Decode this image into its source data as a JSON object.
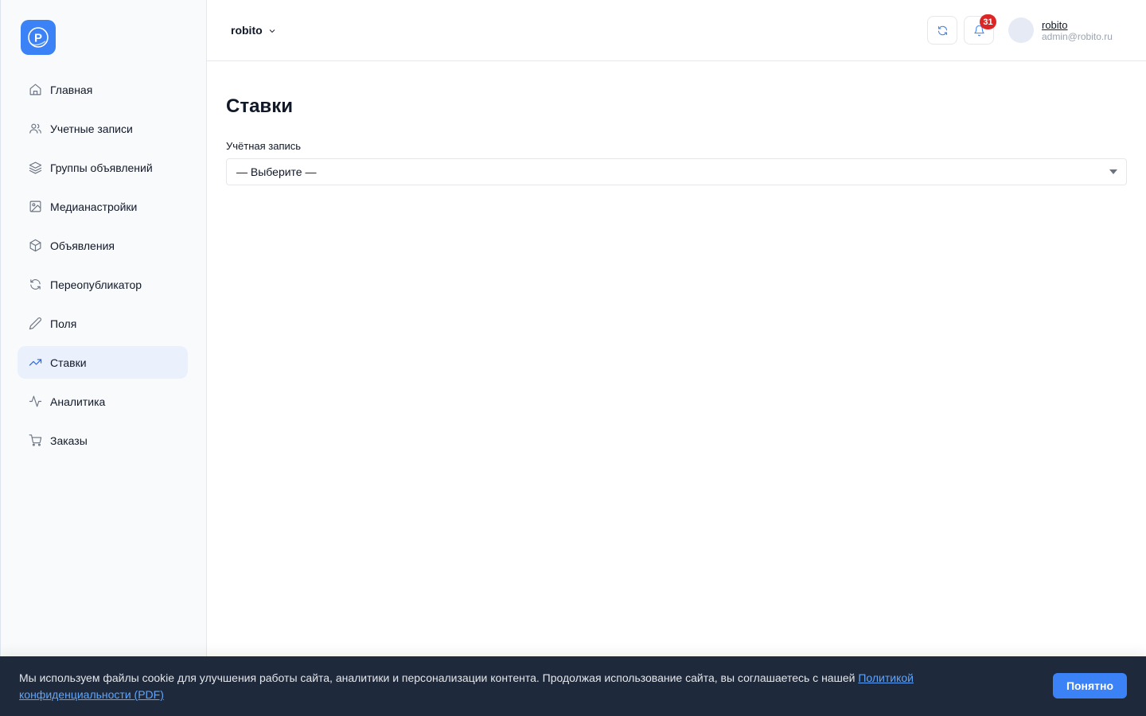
{
  "logo": {
    "letter": "P"
  },
  "sidebar": {
    "items": [
      {
        "label": "Главная",
        "icon": "home-icon"
      },
      {
        "label": "Учетные записи",
        "icon": "users-icon"
      },
      {
        "label": "Группы объявлений",
        "icon": "layers-icon"
      },
      {
        "label": "Медианастройки",
        "icon": "image-icon"
      },
      {
        "label": "Объявления",
        "icon": "box-icon"
      },
      {
        "label": "Переопубликатор",
        "icon": "refresh-icon"
      },
      {
        "label": "Поля",
        "icon": "pencil-icon"
      },
      {
        "label": "Ставки",
        "icon": "trending-up-icon",
        "active": true
      },
      {
        "label": "Аналитика",
        "icon": "activity-icon"
      },
      {
        "label": "Заказы",
        "icon": "cart-icon"
      }
    ]
  },
  "header": {
    "workspace": "robito",
    "notifications_count": "31",
    "user": {
      "name": "robito",
      "email": "admin@robito.ru"
    }
  },
  "main": {
    "title": "Ставки",
    "field_label": "Учётная запись",
    "select_value": "— Выберите —"
  },
  "cookie": {
    "text": "Мы используем файлы cookie для улучшения работы сайта, аналитики и персонализации контента. Продолжая использование сайта, вы соглашаетесь с нашей ",
    "link_text": "Политикой конфиденциальности (PDF)",
    "button_label": "Понятно"
  },
  "colors": {
    "accent": "#3b82f6",
    "active_bg": "#eaf1fd",
    "badge": "#dc2626",
    "cookie_bg": "#1e293b"
  }
}
